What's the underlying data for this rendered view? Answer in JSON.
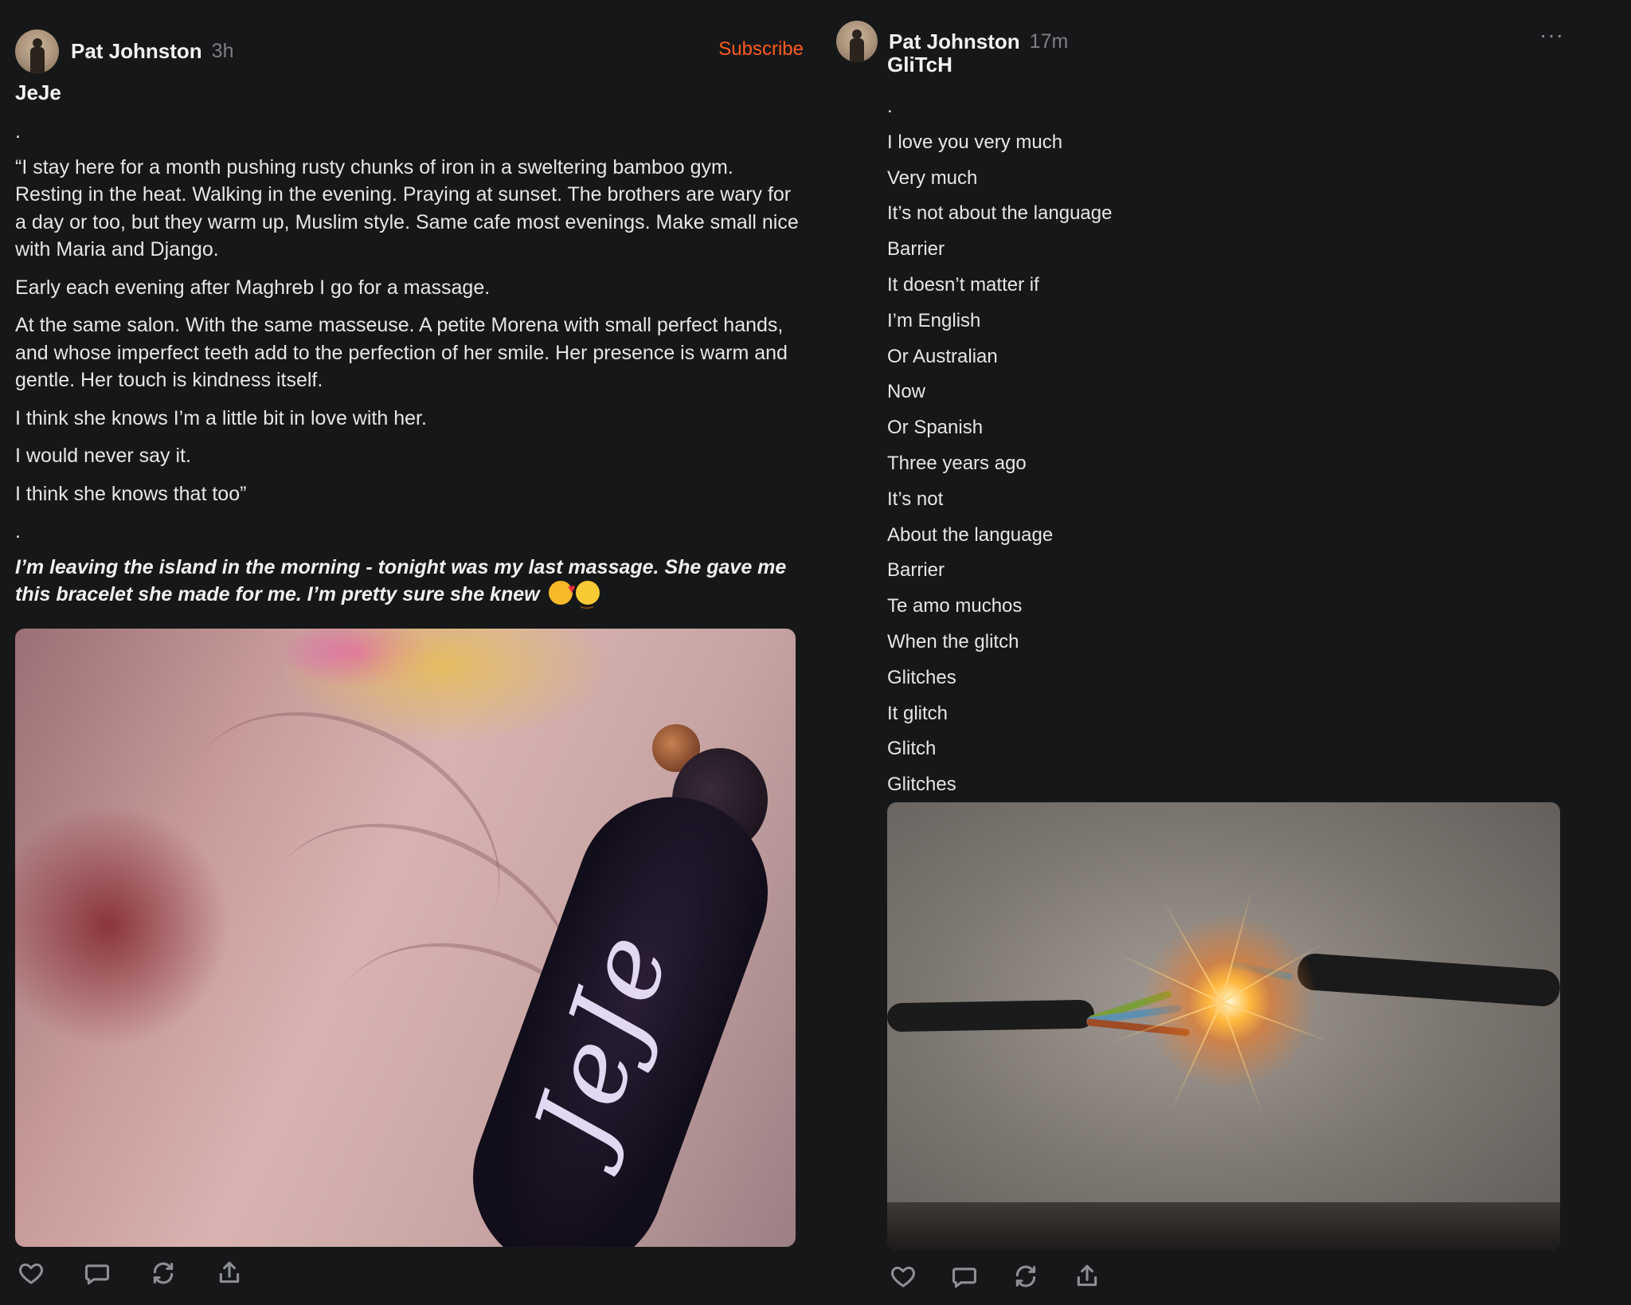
{
  "posts": [
    {
      "author": "Pat Johnston",
      "time": "3h",
      "subscribe_label": "Subscribe",
      "title": "JeJe",
      "paragraphs": [
        ".",
        "“I stay here for a month pushing rusty chunks of iron in a sweltering bamboo gym. Resting in the heat. Walking in the evening. Praying at sunset. The brothers are wary for a day or too, but they warm up, Muslim style. Same cafe most evenings. Make small nice with Maria and Django.",
        "Early each evening after Maghreb I go for a massage.",
        "At the same salon. With the same masseuse. A petite Morena with small perfect hands, and whose imperfect teeth add to the perfection of her smile. Her presence is warm and gentle. Her touch is kindness itself.",
        "I think she knows I’m a little bit in love with her.",
        "I would never say it.",
        "I think she knows that too”",
        "."
      ],
      "emphasis": "I’m leaving the island in the morning - tonight was my last massage. She gave me this bracelet she made for me. I’m pretty sure she knew",
      "emojis": [
        "smiling-face-with-hearts",
        "smiling-face"
      ],
      "image": {
        "text": "JeJe"
      }
    },
    {
      "author": "Pat Johnston",
      "time": "17m",
      "more_label": "···",
      "title": "GliTcH",
      "lines": [
        ".",
        "I love you very much",
        "Very much",
        "It’s not about the language",
        "Barrier",
        "It doesn’t matter if",
        "I’m English",
        "Or Australian",
        "Now",
        "Or Spanish",
        "Three years ago",
        "It’s not",
        "About the language",
        "Barrier",
        "Te amo muchos",
        "When the glitch",
        "Glitches",
        "It glitch",
        "Glitch",
        "Glitches"
      ]
    }
  ],
  "actions": [
    "heart-icon",
    "comment-icon",
    "repost-icon",
    "share-icon"
  ],
  "colors": {
    "background": "#161718",
    "accent": "#ff5b1f",
    "muted": "#7c7e82"
  }
}
